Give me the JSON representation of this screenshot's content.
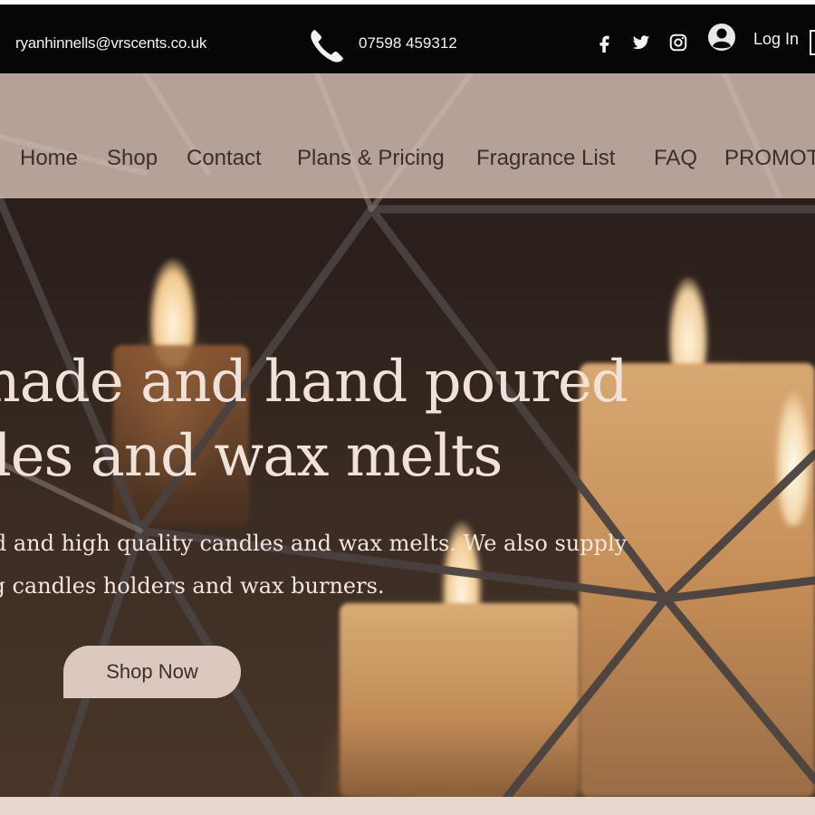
{
  "header": {
    "email": "ryanhinnells@vrscents.co.uk",
    "phone": "07598 459312",
    "login_label": "Log In",
    "social": [
      "facebook-icon",
      "twitter-icon",
      "instagram-icon"
    ]
  },
  "nav": {
    "items": [
      {
        "label": "Home"
      },
      {
        "label": "Shop"
      },
      {
        "label": "Contact"
      },
      {
        "label": "Plans & Pricing"
      },
      {
        "label": "Fragrance List"
      },
      {
        "label": "FAQ"
      },
      {
        "label": "PROMOT"
      }
    ]
  },
  "hero": {
    "headline_line1": "made and hand poured",
    "headline_line2": "ndles and wax melts",
    "sub_line1": "ted and high quality candles and wax melts. We also supply",
    "sub_line2": "ng candles holders and wax burners.",
    "button_label": "Shop Now"
  },
  "colors": {
    "topbar": "#060606",
    "nav_band": "#d4beb4",
    "button": "#dcc8bf",
    "headline_text": "#f0e2d8"
  }
}
